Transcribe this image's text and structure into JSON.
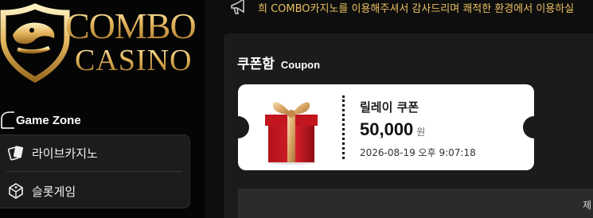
{
  "logo": {
    "line1": "COMBO",
    "line2": "CASINO"
  },
  "sidebar": {
    "section_title": "Game Zone",
    "items": [
      {
        "label": "라이브카지노",
        "icon": "playing-cards-icon"
      },
      {
        "label": "슬롯게임",
        "icon": "slot-machine-icon"
      }
    ]
  },
  "notice": {
    "icon": "megaphone-icon",
    "text": "희 COMBO카지노를 이용해주셔서 감사드리며 쾌적한 환경에서 이용하실"
  },
  "panel": {
    "title_ko": "쿠폰함",
    "title_en": "Coupon"
  },
  "coupon": {
    "name": "릴레이 쿠폰",
    "amount": "50,000",
    "unit": "원",
    "date": "2026-08-19 오후 9:07:18",
    "icon": "gift-box-icon"
  },
  "table": {
    "header_fragment": "제"
  },
  "colors": {
    "gold": "#e3b45a",
    "notice": "#e9c061",
    "panel": "#1b1b1b",
    "coupon_bg": "#ffffff"
  }
}
